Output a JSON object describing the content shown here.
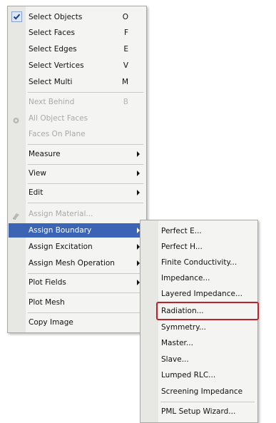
{
  "main_menu": {
    "select_objects": {
      "label": "Select Objects",
      "shortcut": "O"
    },
    "select_faces": {
      "label": "Select Faces",
      "shortcut": "F"
    },
    "select_edges": {
      "label": "Select Edges",
      "shortcut": "E"
    },
    "select_vertices": {
      "label": "Select Vertices",
      "shortcut": "V"
    },
    "select_multi": {
      "label": "Select Multi",
      "shortcut": "M"
    },
    "next_behind": {
      "label": "Next Behind",
      "shortcut": "B"
    },
    "all_object_faces": {
      "label": "All Object Faces"
    },
    "faces_on_plane": {
      "label": "Faces On Plane"
    },
    "measure": {
      "label": "Measure"
    },
    "view": {
      "label": "View"
    },
    "edit": {
      "label": "Edit"
    },
    "assign_material": {
      "label": "Assign Material..."
    },
    "assign_boundary": {
      "label": "Assign Boundary"
    },
    "assign_excitation": {
      "label": "Assign Excitation"
    },
    "assign_mesh_operation": {
      "label": "Assign Mesh Operation"
    },
    "plot_fields": {
      "label": "Plot Fields"
    },
    "plot_mesh": {
      "label": "Plot Mesh"
    },
    "copy_image": {
      "label": "Copy Image"
    }
  },
  "submenu": {
    "perfect_e": "Perfect E...",
    "perfect_h": "Perfect H...",
    "finite_conductivity": "Finite Conductivity...",
    "impedance": "Impedance...",
    "layered_impedance": "Layered Impedance...",
    "radiation": "Radiation...",
    "symmetry": "Symmetry...",
    "master": "Master...",
    "slave": "Slave...",
    "lumped_rlc": "Lumped RLC...",
    "screening_impedance": "Screening Impedance",
    "pml_setup_wizard": "PML Setup Wizard..."
  },
  "colors": {
    "highlight": "#3c64b4",
    "focus_outline": "#c0202a",
    "disabled_text": "#a9a9a6"
  }
}
